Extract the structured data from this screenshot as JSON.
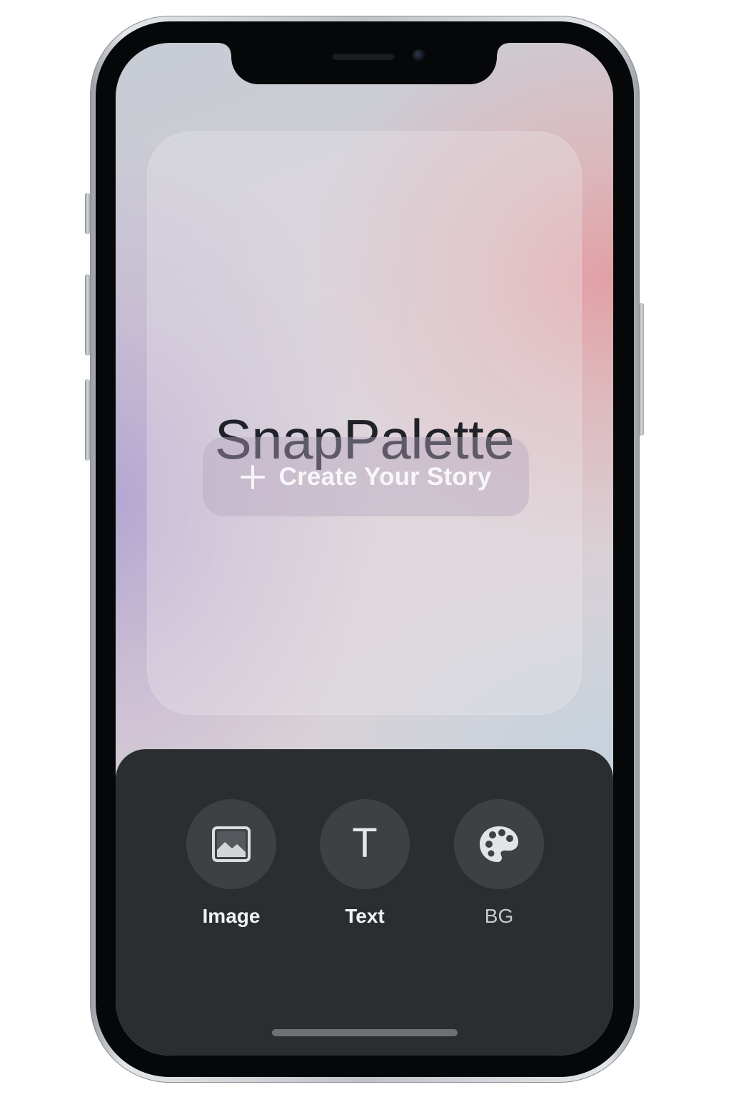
{
  "app": {
    "title": "SnapPalette"
  },
  "hero": {
    "create_button_label": "Create Your Story",
    "create_button_icon": "plus-icon"
  },
  "toolbar": {
    "tools": [
      {
        "label": "Image",
        "icon": "image-icon"
      },
      {
        "label": "Text",
        "icon": "text-icon",
        "glyph": "T"
      },
      {
        "label": "BG",
        "icon": "palette-icon"
      }
    ]
  },
  "colors": {
    "toolbar_background": "#2b2e31",
    "tool_circle": "#3d4144",
    "title_text": "#1f2228",
    "gradient_pink": "#e29ea3",
    "gradient_lavender": "#b2a5d2",
    "gradient_blue_gray": "#c4d2de"
  }
}
